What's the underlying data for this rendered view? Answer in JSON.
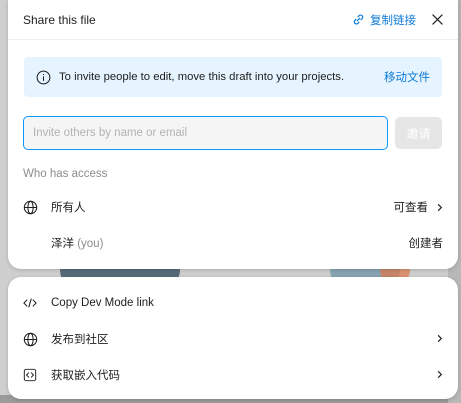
{
  "header": {
    "title": "Share this file",
    "copy_link_label": "复制链接",
    "close_icon": "close-icon"
  },
  "banner": {
    "message": "To invite people to edit, move this draft into your projects.",
    "action_label": "移动文件",
    "icon": "info-icon"
  },
  "invite": {
    "placeholder": "Invite others by name or email",
    "value": "",
    "button_label": "邀请"
  },
  "access": {
    "section_label": "Who has access",
    "rows": [
      {
        "label": "所有人",
        "value": "可查看",
        "icon": "globe-icon"
      },
      {
        "name": "泽洋",
        "you": "(you)",
        "role": "创建者"
      }
    ]
  },
  "actions": [
    {
      "label": "Copy Dev Mode link",
      "icon": "code-icon"
    },
    {
      "label": "发布到社区",
      "icon": "globe-icon"
    },
    {
      "label": "获取嵌入代码",
      "icon": "embed-icon"
    }
  ],
  "colors": {
    "accent": "#0d7ad7",
    "focus_border": "#0d99ff",
    "banner_bg": "#e5f4ff",
    "muted_text": "#8c8c8c"
  }
}
